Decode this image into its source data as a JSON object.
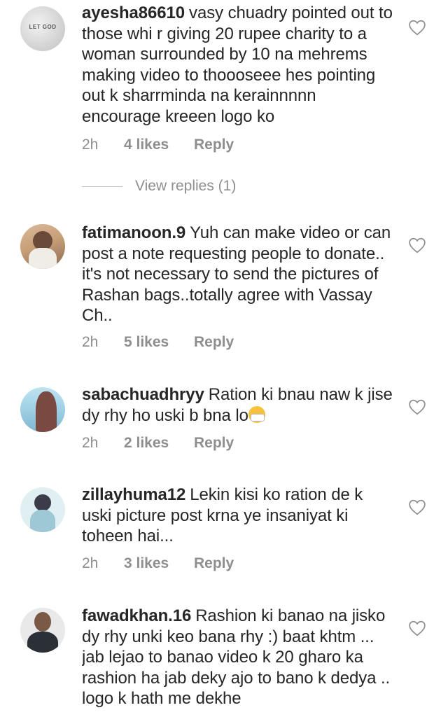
{
  "comments": [
    {
      "username": "ayesha86610",
      "avatar_text": "LET GOD",
      "text": "vasy chuadry pointed out to those whi r giving 20 rupee charity to a woman surrounded by 10 na mehrems making video to thoooseee hes pointing out k sharrminda na kerainnnnn encourage kreeen logo ko",
      "time": "2h",
      "likes": "4 likes",
      "reply": "Reply",
      "view_replies": "View replies (1)"
    },
    {
      "username": "fatimanoon.9",
      "text": "Yuh can make video or can post  a note requesting people to donate.. it's not necessary to send the pictures of Rashan bags..totally agree with Vassay Ch..",
      "time": "2h",
      "likes": "5 likes",
      "reply": "Reply"
    },
    {
      "username": "sabachuadhryy",
      "text": "Ration ki bnau naw k jise dy rhy ho uski b bna lo",
      "emoji": "face-with-medical-mask",
      "time": "2h",
      "likes": "2 likes",
      "reply": "Reply"
    },
    {
      "username": "zillayhuma12",
      "text": "Lekin kisi ko ration de k uski picture post krna ye insaniyat ki toheen hai...",
      "time": "2h",
      "likes": "3 likes",
      "reply": "Reply"
    },
    {
      "username": "fawadkhan.16",
      "text": "Rashion ki banao na jisko dy rhy unki keo bana rhy :) baat khtm ... jab lejao to banao video k 20 gharo ka rashion ha jab deky ajo to bano k dedya .. logo k hath me dekhe"
    }
  ],
  "icons": {
    "like": "heart-outline-icon"
  },
  "colors": {
    "text": "#262626",
    "muted": "#8e8e8e"
  }
}
